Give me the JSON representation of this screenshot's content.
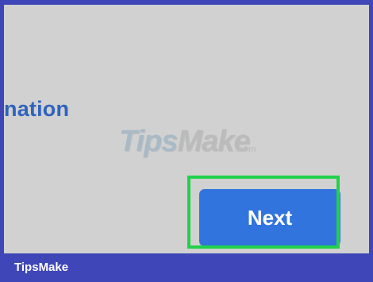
{
  "screen": {
    "partial_title": "nation",
    "watermark": {
      "tips": "Tips",
      "make": "Make",
      "domain": ".com"
    },
    "next_button_label": "Next"
  },
  "footer": {
    "brand": "TipsMake"
  },
  "colors": {
    "frame": "#3f46b8",
    "background": "#d1d1d1",
    "accent_text": "#2f63bd",
    "button": "#3174dd",
    "highlight": "#22d14b",
    "footer_text": "#ffffff"
  }
}
